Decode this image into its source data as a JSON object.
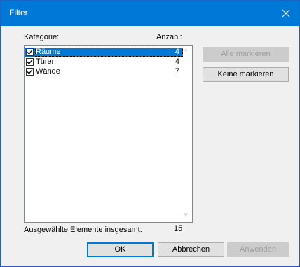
{
  "window": {
    "title": "Filter"
  },
  "columns": {
    "category": "Kategorie:",
    "count": "Anzahl:"
  },
  "items": [
    {
      "label": "Räume",
      "count": "4",
      "checked": true,
      "selected": true
    },
    {
      "label": "Türen",
      "count": "4",
      "checked": true,
      "selected": false
    },
    {
      "label": "Wände",
      "count": "7",
      "checked": true,
      "selected": false
    }
  ],
  "side_buttons": {
    "select_all": "Alle markieren",
    "deselect_all": "Keine markieren"
  },
  "footer": {
    "total_label": "Ausgewählte Elemente insgesamt:",
    "total_value": "15"
  },
  "buttons": {
    "ok": "OK",
    "cancel": "Abbrechen",
    "apply": "Anwenden"
  },
  "colors": {
    "titlebar": "#0078d7",
    "selection": "#0078d7"
  }
}
